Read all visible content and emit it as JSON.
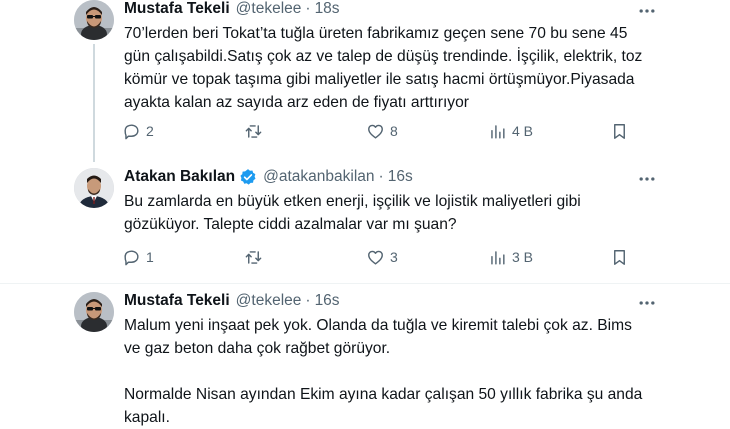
{
  "tweets": [
    {
      "name": "Mustafa Tekeli",
      "handle": "@tekelee",
      "dot": "·",
      "time": "18s",
      "verified": false,
      "body": [
        "70’lerden beri Tokat’ta tuğla üreten fabrikamız geçen sene 70 bu sene 45 gün çalışabildi.Satış çok az ve talep de düşüş trendinde. İşçilik, elektrik, toz kömür ve topak taşıma gibi maliyetler ile satış hacmi örtüşmüyor.Piyasada ayakta kalan az sayıda arz eden de fiyatı arttırıyor"
      ],
      "replies": "2",
      "retweets": "",
      "likes": "8",
      "views": "4 B"
    },
    {
      "name": "Atakan Bakılan",
      "handle": "@atakanbakilan",
      "dot": "·",
      "time": "16s",
      "verified": true,
      "body": [
        "Bu zamlarda en büyük etken enerji, işçilik ve lojistik maliyetleri gibi gözüküyor. Talepte ciddi azalmalar var mı şuan?"
      ],
      "replies": "1",
      "retweets": "",
      "likes": "3",
      "views": "3 B"
    },
    {
      "name": "Mustafa Tekeli",
      "handle": "@tekelee",
      "dot": "·",
      "time": "16s",
      "verified": false,
      "body": [
        "Malum yeni inşaat pek yok. Olanda da tuğla ve kiremit talebi çok az. Bims ve gaz beton daha çok rağbet görüyor.",
        "Normalde Nisan ayından Ekim ayına kadar çalışan 50 yıllık fabrika şu anda kapalı."
      ]
    }
  ],
  "colors": {
    "text": "#0f1419",
    "muted": "#536471",
    "verified": "#1d9bf0",
    "border": "#eff3f4",
    "thread_line": "#cfd9de"
  }
}
